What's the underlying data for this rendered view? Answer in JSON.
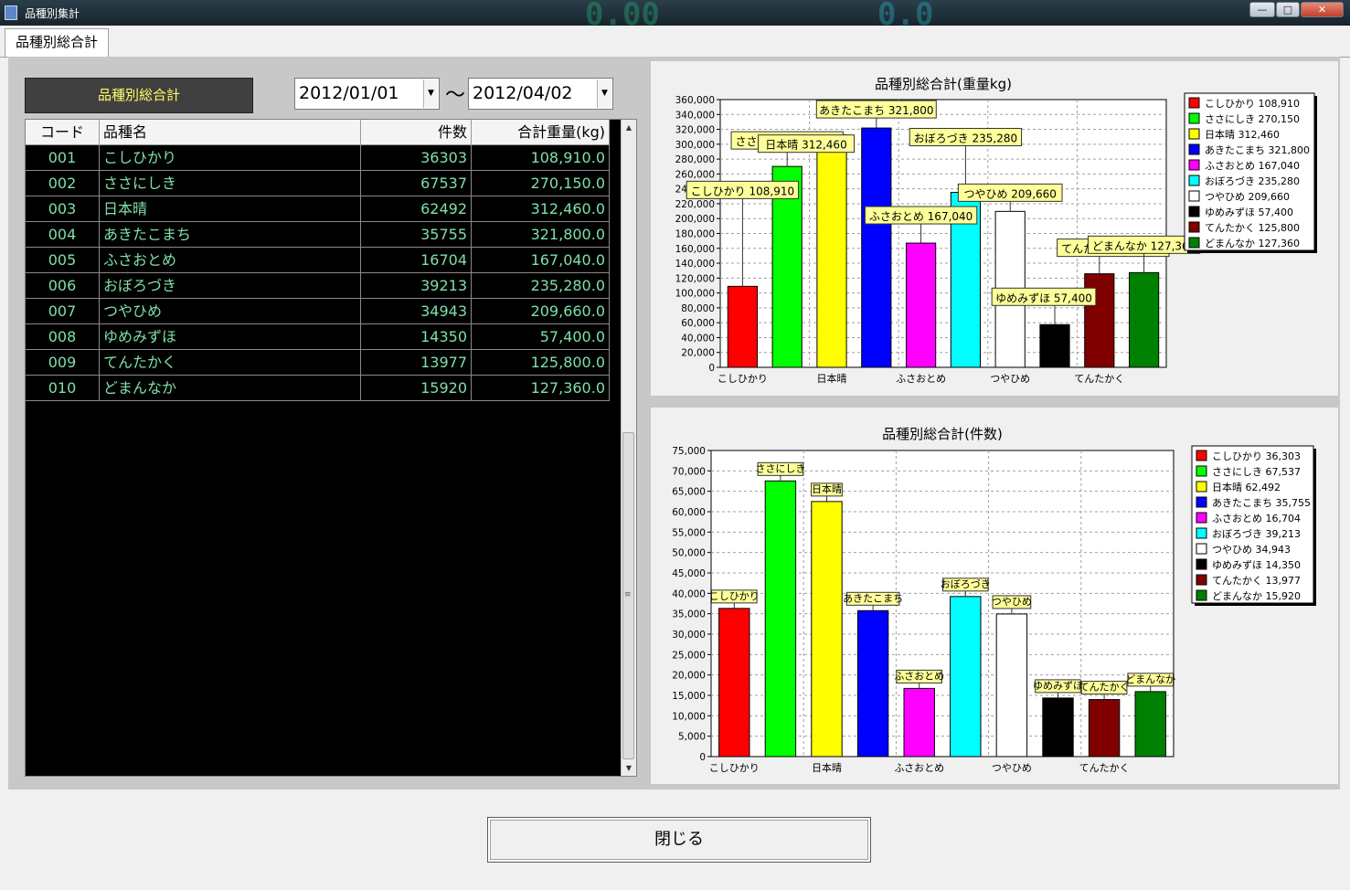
{
  "window": {
    "title": "品種別集計",
    "controls": {
      "minimize": "—",
      "maximize": "□",
      "close": "✕"
    }
  },
  "tab": {
    "label": "品種別総合計"
  },
  "left": {
    "heading": "品種別総合計",
    "date_from": "2012/01/01",
    "date_sep": "～",
    "date_to": "2012/04/02",
    "columns": [
      "コード",
      "品種名",
      "件数",
      "合計重量(kg)"
    ],
    "rows": [
      [
        "001",
        "こしひかり",
        "36303",
        "108,910.0"
      ],
      [
        "002",
        "ささにしき",
        "67537",
        "270,150.0"
      ],
      [
        "003",
        "日本晴",
        "62492",
        "312,460.0"
      ],
      [
        "004",
        "あきたこまち",
        "35755",
        "321,800.0"
      ],
      [
        "005",
        "ふさおとめ",
        "16704",
        "167,040.0"
      ],
      [
        "006",
        "おぼろづき",
        "39213",
        "235,280.0"
      ],
      [
        "007",
        "つやひめ",
        "34943",
        "209,660.0"
      ],
      [
        "008",
        "ゆめみずほ",
        "14350",
        "57,400.0"
      ],
      [
        "009",
        "てんたかく",
        "13977",
        "125,800.0"
      ],
      [
        "010",
        "どまんなか",
        "15920",
        "127,360.0"
      ]
    ],
    "colors": {
      "grid_bg": "#000000",
      "grid_text": "#7fe0a8",
      "heading_text": "#ffff66"
    }
  },
  "colors": [
    "#ff0000",
    "#00ff00",
    "#ffff00",
    "#0000ff",
    "#ff00ff",
    "#00ffff",
    "#ffffff",
    "#000000",
    "#800000",
    "#008000"
  ],
  "chart_data": [
    {
      "type": "bar",
      "title": "品種別総合計(重量kg)",
      "categories": [
        "こしひかり",
        "ささにしき",
        "日本晴",
        "あきたこまち",
        "ふさおとめ",
        "おぼろづき",
        "つやひめ",
        "ゆめみずほ",
        "てんたかく",
        "どまんなか"
      ],
      "values": [
        108910,
        270150,
        312460,
        321800,
        167040,
        235280,
        209660,
        57400,
        125800,
        127360
      ],
      "shown_xticks": [
        "こしひかり",
        "日本晴",
        "ふさおとめ",
        "つやひめ",
        "てんたかく"
      ],
      "ylim": [
        0,
        360000
      ],
      "yticks": [
        "0",
        "20,000",
        "40,000",
        "60,000",
        "80,000",
        "100,000",
        "120,000",
        "140,000",
        "160,000",
        "180,000",
        "200,000",
        "220,000",
        "240,000",
        "260,000",
        "280,000",
        "300,000",
        "320,000",
        "340,000",
        "360,000"
      ],
      "bar_labels": [
        "こしひかり 108,910",
        "ささにしき 270,150",
        "日本晴 312,460",
        "あきたこまち 321,800",
        "ふさおとめ 167,040",
        "おぼろづき 235,280",
        "つやひめ 209,660",
        "ゆめみずほ 57,400",
        "てんたかく 125,800",
        "どまんなか 127,360"
      ],
      "legend": [
        "こしひかり 108,910",
        "ささにしき 270,150",
        "日本晴 312,460",
        "あきたこまち 321,800",
        "ふさおとめ 167,040",
        "おぼろづき 235,280",
        "つやひめ 209,660",
        "ゆめみずほ 57,400",
        "てんたかく 125,800",
        "どまんなか 127,360"
      ],
      "legend_position": "right",
      "grid": true
    },
    {
      "type": "bar",
      "title": "品種別総合計(件数)",
      "categories": [
        "こしひかり",
        "ささにしき",
        "日本晴",
        "あきたこまち",
        "ふさおとめ",
        "おぼろづき",
        "つやひめ",
        "ゆめみずほ",
        "てんたかく",
        "どまんなか"
      ],
      "values": [
        36303,
        67537,
        62492,
        35755,
        16704,
        39213,
        34943,
        14350,
        13977,
        15920
      ],
      "shown_xticks": [
        "こしひかり",
        "日本晴",
        "ふさおとめ",
        "つやひめ",
        "てんたかく"
      ],
      "ylim": [
        0,
        75000
      ],
      "yticks": [
        "0",
        "5,000",
        "10,000",
        "15,000",
        "20,000",
        "25,000",
        "30,000",
        "35,000",
        "40,000",
        "45,000",
        "50,000",
        "55,000",
        "60,000",
        "65,000",
        "70,000",
        "75,000"
      ],
      "bar_labels": [
        "こしひかり",
        "ささにしき",
        "日本晴",
        "あきたこまち",
        "ふさおとめ",
        "おぼろづき",
        "つやひめ",
        "ゆめみずほ",
        "てんたかく",
        "どまんなか"
      ],
      "legend": [
        "こしひかり 36,303",
        "ささにしき 67,537",
        "日本晴 62,492",
        "あきたこまち 35,755",
        "ふさおとめ 16,704",
        "おぼろづき 39,213",
        "つやひめ 34,943",
        "ゆめみずほ 14,350",
        "てんたかく 13,977",
        "どまんなか 15,920"
      ],
      "legend_position": "right",
      "grid": true
    }
  ],
  "footer": {
    "close_label": "閉じる"
  }
}
